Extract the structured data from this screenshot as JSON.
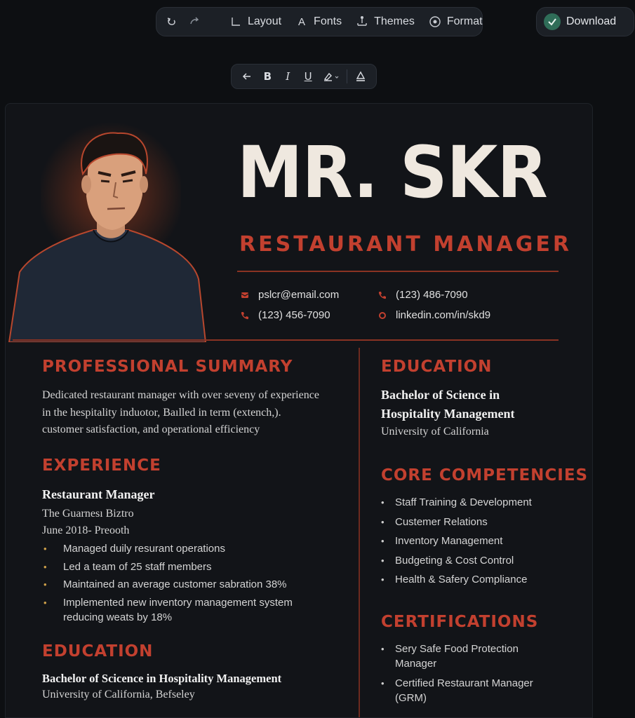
{
  "toolbar": {
    "layout_label": "Layout",
    "fonts_label": "Fonts",
    "fonts_icon_glyph": "A",
    "themes_label": "Themes",
    "format_label": "Format",
    "download_label": "Download"
  },
  "format_bar": {
    "bold": "B",
    "italic": "I",
    "underline": "U"
  },
  "resume": {
    "name": "MR. SKR",
    "title": "RESTAURANT MANAGER",
    "contact": {
      "email": "pslcr@email.com",
      "phone1": "(123) 486-7090",
      "phone2": "(123) 456-7090",
      "linkedin": "linkedin.com/in/skd9"
    },
    "summary": {
      "heading": "PROFESSIONAL SUMMARY",
      "lines": [
        "Dedicated restaurant manager with over seveny of experience",
        "in the hespitality induotor, Baılled in term (extench,).",
        "customer satisfaction, and operational efficiency"
      ]
    },
    "experience": {
      "heading": "EXPERIENCE",
      "role": "Restaurant Manager",
      "company": "The Guarnesı Biztro",
      "dates": "June 2018- Preooth",
      "bullets": [
        "Managed duily resurant operations",
        "Led a team of 25 staff members",
        "Maintained an average customer sabration 38%",
        "Implemented new inventory management system reducing weats by 18%"
      ]
    },
    "education_left": {
      "heading": "EDUCATION",
      "degree": "Bachelor of Scicence in Hospitality Management",
      "school": "University of California, Befseley"
    },
    "education_right": {
      "heading": "EDUCATION",
      "degree_line1": "Bachelor of Science in",
      "degree_line2": "Hospitality Management",
      "school": "University of California"
    },
    "competencies": {
      "heading": "CORE COMPETENCIES",
      "items": [
        "Staff Training & Development",
        "Custemer Relations",
        "Inventory Management",
        "Budgeting & Cost Control",
        "Health & Safery Compliance"
      ]
    },
    "certifications": {
      "heading": "CERTIFICATIONS",
      "items": [
        "Sery Safe Food Protection Manager",
        "Certified Restaurant Manager (GRM)"
      ]
    }
  },
  "colors": {
    "accent": "#c2402f",
    "background": "#0d0f12",
    "panel": "#1c2026",
    "download_check": "#2f6d58"
  }
}
